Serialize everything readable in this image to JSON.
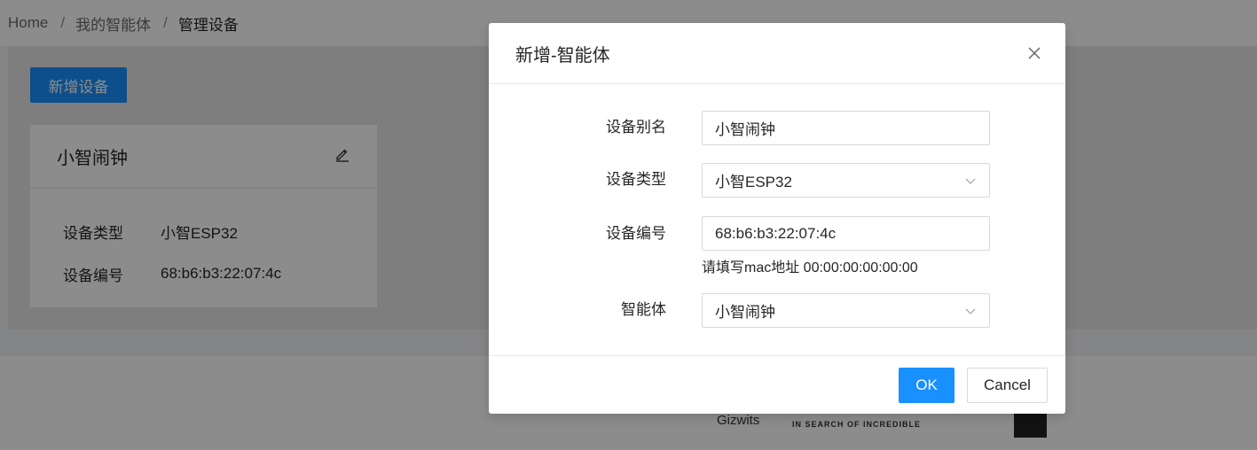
{
  "breadcrumb": {
    "items": [
      "Home",
      "我的智能体",
      "管理设备"
    ],
    "separator": "/"
  },
  "toolbar": {
    "add_device_label": "新增设备"
  },
  "device_card": {
    "title": "小智闹钟",
    "rows": [
      {
        "key": "设备类型",
        "value": "小智ESP32"
      },
      {
        "key": "设备编号",
        "value": "68:b6:b3:22:07:4c"
      }
    ]
  },
  "footer": {
    "partners": [
      "Gizwits",
      "IN SEARCH OF INCREDIBLE"
    ]
  },
  "modal": {
    "title": "新增-智能体",
    "fields": {
      "alias": {
        "label": "设备别名",
        "value": "小智闹钟"
      },
      "type": {
        "label": "设备类型",
        "value": "小智ESP32"
      },
      "serial": {
        "label": "设备编号",
        "value": "68:b6:b3:22:07:4c",
        "hint": "请填写mac地址 00:00:00:00:00:00"
      },
      "agent": {
        "label": "智能体",
        "value": "小智闹钟"
      }
    },
    "ok_label": "OK",
    "cancel_label": "Cancel"
  },
  "colors": {
    "primary": "#1890ff",
    "overlay": "rgba(0,0,0,0.45)"
  },
  "icons": {
    "edit": "edit-icon",
    "close": "close-icon",
    "chevron": "chevron-down-icon"
  }
}
